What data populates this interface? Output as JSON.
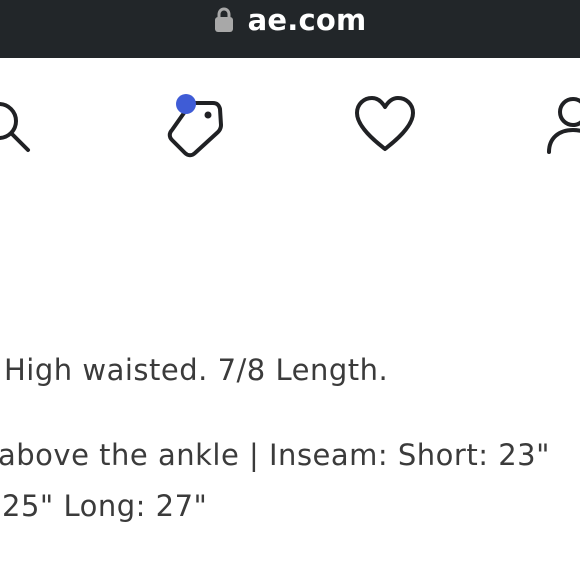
{
  "browser": {
    "url": "ae.com"
  },
  "header": {
    "icons": [
      "search-icon",
      "shopping-bag-icon",
      "heart-icon",
      "account-icon"
    ],
    "bag_badge_color": "#3f5cd6"
  },
  "product": {
    "description_line_1": "High waisted. 7/8 Length.",
    "description_line_2": "above the ankle | Inseam: Short: 23\"",
    "description_line_3": "25\" Long: 27\""
  },
  "colors": {
    "url_bar": "#222629",
    "text": "#3b3b3b",
    "icon": "#202124",
    "badge": "#3f5cd6"
  }
}
